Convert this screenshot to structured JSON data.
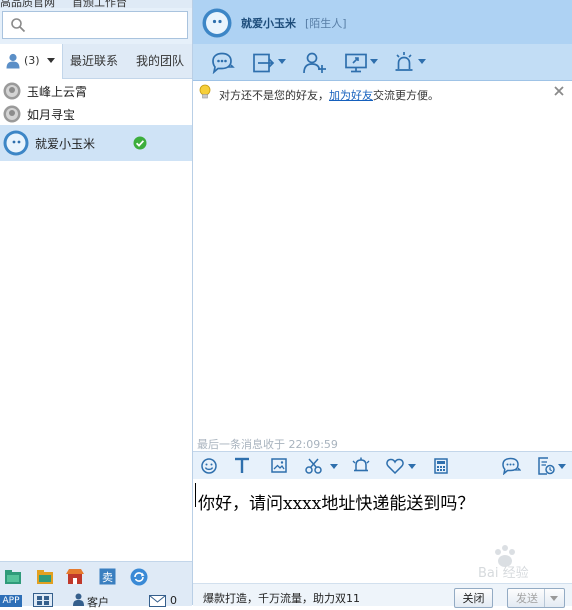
{
  "top_strip": {
    "left_text": "高品质官网",
    "right_text": "首颁工作台"
  },
  "search": {
    "icon": "search-icon"
  },
  "left_tabs": {
    "contacts_count": "(3)",
    "recent": "最近联系",
    "team": "我的团队"
  },
  "contacts": [
    {
      "name": "玉峰上云霄"
    },
    {
      "name": "如月寻宝"
    },
    {
      "name": "就爱小玉米",
      "selected": true,
      "status": "online"
    }
  ],
  "footer": {
    "app_label": "APP",
    "customer_label": "客户",
    "mail_count": "0"
  },
  "chat": {
    "title": "就爱小玉米",
    "subtitle": "[陌生人]"
  },
  "notice": {
    "prefix": "对方还不是您的好友，",
    "link": "加为好友",
    "suffix": "交流更方便。"
  },
  "last_message": "最后一条消息收于 22:09:59",
  "input": {
    "text": "你好，请问xxxx地址快递能送到吗？"
  },
  "bottom": {
    "ad": "爆款打造，千万流量，助力双11",
    "close_label": "关闭",
    "send_label": "发送"
  },
  "watermark": {
    "text": "Bai 经验"
  },
  "colors": {
    "header": "#aed2f3",
    "toolbar": "#c2ddf5",
    "selected_row": "#cfe3f6",
    "icon_blue": "#2e6fad",
    "online_green": "#3cae3c",
    "link": "#1560bd"
  }
}
